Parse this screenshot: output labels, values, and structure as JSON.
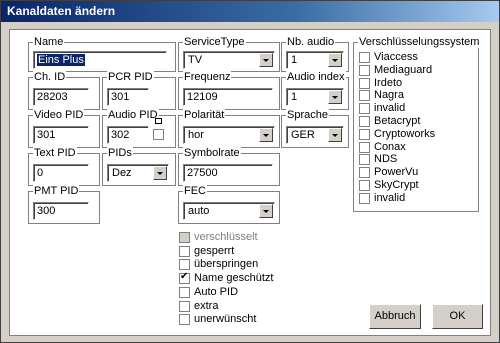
{
  "window": {
    "title": "Kanaldaten ändern"
  },
  "fields": {
    "name": {
      "label": "Name",
      "value": "Eins Plus"
    },
    "servicetype": {
      "label": "ServiceType",
      "value": "TV"
    },
    "nb_audio": {
      "label": "Nb. audio",
      "value": "1"
    },
    "ch_id": {
      "label": "Ch. ID",
      "value": "28203"
    },
    "pcr_pid": {
      "label": "PCR PID",
      "value": "301"
    },
    "frequenz": {
      "label": "Frequenz",
      "value": "12109"
    },
    "audio_index": {
      "label": "Audio index",
      "value": "1"
    },
    "video_pid": {
      "label": "Video PID",
      "value": "301"
    },
    "audio_pid": {
      "label": "Audio PID",
      "value": "302"
    },
    "polaritaet": {
      "label": "Polarität",
      "value": "hor"
    },
    "sprache": {
      "label": "Sprache",
      "value": "GER"
    },
    "text_pid": {
      "label": "Text PID",
      "value": "0"
    },
    "pids": {
      "label": "PIDs",
      "value": "Dez"
    },
    "symbolrate": {
      "label": "Symbolrate",
      "value": "27500"
    },
    "pmt_pid": {
      "label": "PMT PID",
      "value": "300"
    },
    "fec": {
      "label": "FEC",
      "value": "auto"
    }
  },
  "encryption": {
    "label": "Verschlüsselungssystem",
    "items": [
      "Viaccess",
      "Mediaguard",
      "Irdeto",
      "Nagra",
      "invalid",
      "Betacrypt",
      "Cryptoworks",
      "Conax",
      "NDS",
      "PowerVu",
      "SkyCrypt",
      "invalid"
    ]
  },
  "options": [
    {
      "label": "verschlüsselt",
      "checked": false,
      "disabled": true
    },
    {
      "label": "gesperrt",
      "checked": false,
      "disabled": false
    },
    {
      "label": "überspringen",
      "checked": false,
      "disabled": false
    },
    {
      "label": "Name geschützt",
      "checked": true,
      "disabled": false
    },
    {
      "label": "Auto PID",
      "checked": false,
      "disabled": false
    },
    {
      "label": "extra",
      "checked": false,
      "disabled": false
    },
    {
      "label": "unerwünscht",
      "checked": false,
      "disabled": false
    }
  ],
  "buttons": {
    "cancel": "Abbruch",
    "ok": "OK"
  }
}
